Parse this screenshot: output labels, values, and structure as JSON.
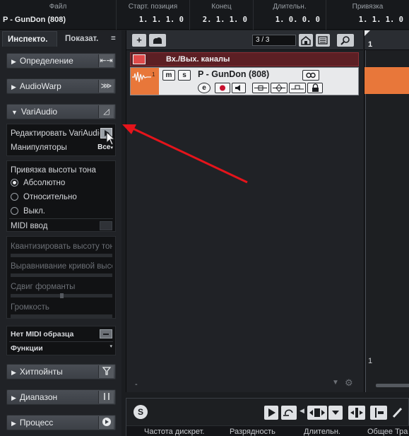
{
  "infoline": {
    "columns": [
      {
        "label": "Файл",
        "value": "P - GunDon (808)"
      },
      {
        "label": "Старт. позиция",
        "value": "1. 1. 1.   0"
      },
      {
        "label": "Конец",
        "value": "2. 1. 1.   0"
      },
      {
        "label": "Длительн.",
        "value": "1. 0. 0.   0"
      },
      {
        "label": "Привязка",
        "value": "1. 1. 1.   0"
      }
    ]
  },
  "inspector": {
    "tabs": {
      "active": "Инспекто.",
      "inactive": "Показат.",
      "menu": "="
    },
    "sections": {
      "definition": {
        "label": "Определение",
        "icon": "⇤⇥"
      },
      "audiowarp": {
        "label": "AudioWarp",
        "icon": "⋙"
      },
      "variaudio": {
        "label": "VariAudio",
        "icon": "◿"
      },
      "hitpoints": {
        "label": "Хитпойнты",
        "icon": "⏚"
      },
      "range": {
        "label": "Диапазон",
        "icon": "⎸⎹"
      },
      "process": {
        "label": "Процесс",
        "icon": "▶"
      }
    },
    "variaudio_panel": {
      "edit_label": "Редактировать VariAudio",
      "manipulators_label": "Манипуляторы",
      "manipulators_value": "Все",
      "pitch_snap_label": "Привязка высоты тона",
      "options": [
        "Абсолютно",
        "Относительно",
        "Выкл."
      ],
      "selected_option": "Абсолютно",
      "midi_input_label": "MIDI ввод",
      "quantize_pitch_label": "Квантизировать высоту тона",
      "straighten_curve_label": "Выравнивание кривой высоты",
      "formant_shift_label": "Сдвиг форманты",
      "formant_shift_level": 0.5,
      "volume_label": "Громкость"
    },
    "midi_panel": {
      "no_midi_label": "Нет MIDI образца",
      "functions_label": "Функции"
    }
  },
  "project": {
    "toolbar": {
      "add_label": "+",
      "counter": "3 / 3"
    },
    "folder_track": {
      "name": "Вх./Вых. каналы"
    },
    "audio_track": {
      "number": "1",
      "mute": "m",
      "solo": "s",
      "name": "P - GunDon (808)",
      "edit": "e"
    },
    "ruler": {
      "bar": "1",
      "marker": "1"
    },
    "bottom_left": "-"
  },
  "transport": {
    "footer": [
      "Частота дискрет.",
      "Разрядность",
      "Длительн.",
      "Общее Тра"
    ]
  },
  "colors": {
    "track_orange": "#e8773a",
    "folder_red": "#e04a4a",
    "annotation_arrow": "#e5141b"
  }
}
